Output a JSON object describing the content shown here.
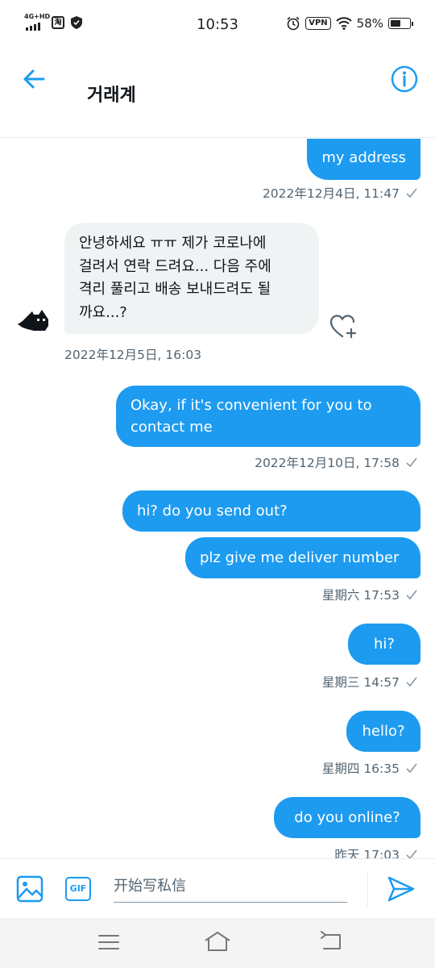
{
  "status_bar": {
    "network": "4G+HD",
    "app_badge": "淘",
    "time": "10:53",
    "vpn": "VPN",
    "battery": "58%",
    "battery_level": 0.58
  },
  "header": {
    "title": "거래계",
    "back_icon": "arrow-left-icon",
    "info_icon": "info-icon"
  },
  "messages": [
    {
      "dir": "out",
      "text": "my address",
      "time": "2022年12月4日, 11:47"
    },
    {
      "dir": "in",
      "text": "안녕하세요 ㅠㅠ 제가 코로나에 걸려서 연락 드려요... 다음 주에 격리 풀리고 배송 보내드려도 될까요...?",
      "lines": [
        "안녕하세요 ㅠㅠ 제가 코로나에",
        "걸려서 연락 드려요... 다음 주에",
        "격리 풀리고 배송 보내드려도 될",
        "까요...?"
      ],
      "time": "2022年12月5日, 16:03"
    },
    {
      "dir": "out",
      "lines": [
        "Okay, if it's convenient for you to",
        "contact me"
      ],
      "time": "2022年12月10日, 17:58"
    },
    {
      "dir": "out",
      "text": "hi? do you send out?"
    },
    {
      "dir": "out",
      "text": "plz give me deliver number",
      "time": "星期六 17:53"
    },
    {
      "dir": "out",
      "text": "hi?",
      "time": "星期三 14:57"
    },
    {
      "dir": "out",
      "text": "hello?",
      "time": "星期四 16:35"
    },
    {
      "dir": "out",
      "text": "do you online?",
      "time": "昨天 17:03"
    }
  ],
  "composer": {
    "placeholder": "开始写私信",
    "gif_label": "GIF",
    "image_icon": "image-icon",
    "send_icon": "send-icon"
  },
  "navbar": {
    "items": [
      "menu-icon",
      "home-icon",
      "back-icon"
    ]
  },
  "colors": {
    "accent": "#1d9bf0",
    "incoming_bubble": "#eff3f4",
    "meta_text": "#536471"
  }
}
